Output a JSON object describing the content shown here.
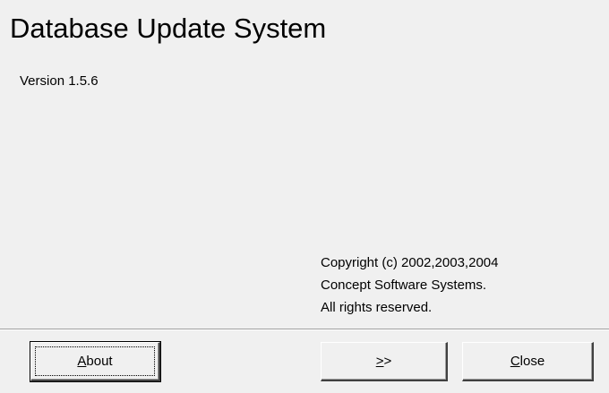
{
  "dialog": {
    "title": "Database Update System",
    "version": "Version 1.5.6",
    "copyright": [
      "Copyright (c) 2002,2003,2004",
      "Concept Software Systems.",
      "All rights reserved."
    ]
  },
  "buttons": {
    "about": {
      "accel": "A",
      "rest": "bout"
    },
    "next": {
      "accel": ">",
      "rest": ">"
    },
    "close": {
      "accel": "C",
      "rest": "lose"
    }
  }
}
